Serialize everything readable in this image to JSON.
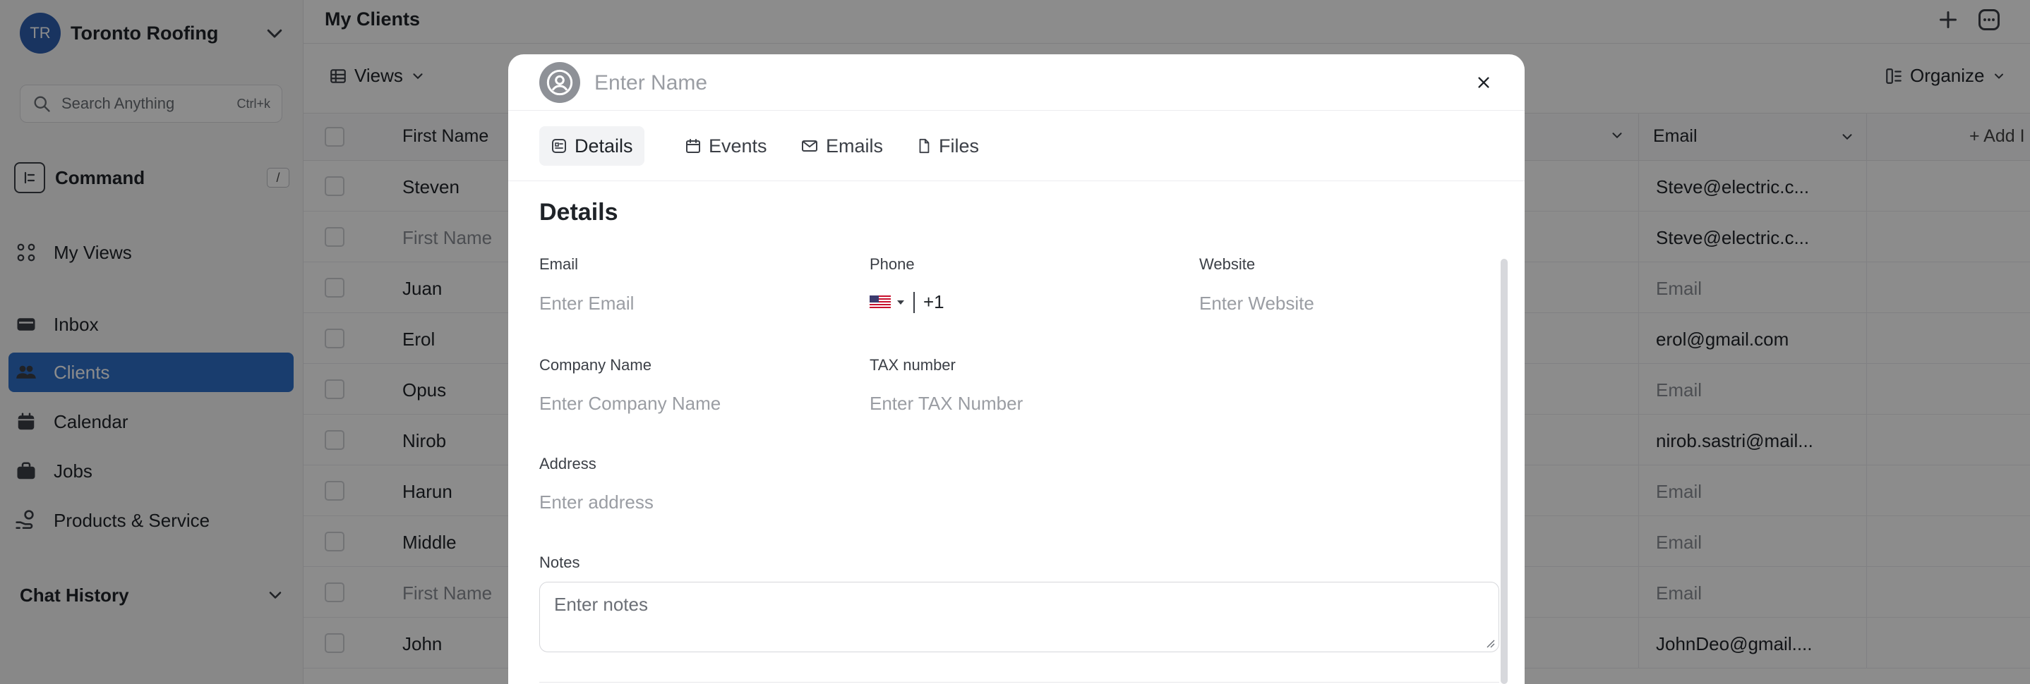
{
  "sidebar": {
    "workspace": {
      "initials": "TR",
      "name": "Toronto Roofing"
    },
    "search": {
      "placeholder": "Search Anything",
      "shortcut": "Ctrl+k"
    },
    "command": {
      "label": "Command",
      "shortcut": "/"
    },
    "items": [
      {
        "label": "My Views",
        "icon": "grid-icon"
      },
      {
        "label": "Inbox",
        "icon": "inbox-icon"
      },
      {
        "label": "Clients",
        "icon": "users-icon",
        "active": true
      },
      {
        "label": "Calendar",
        "icon": "calendar-icon"
      },
      {
        "label": "Jobs",
        "icon": "briefcase-icon"
      },
      {
        "label": "Products & Service",
        "icon": "hand-coin-icon"
      }
    ],
    "chat_history": {
      "label": "Chat History"
    }
  },
  "main": {
    "title": "My Clients",
    "toolbar": {
      "views_label": "Views",
      "organize_label": "Organize"
    },
    "table": {
      "headers": {
        "first_name": "First Name",
        "email": "Email",
        "add_column": "+ Add I"
      },
      "rows": [
        {
          "first": "Steven",
          "first_placeholder": false,
          "email": "Steve@electric.c...",
          "email_placeholder": false
        },
        {
          "first": "First Name",
          "first_placeholder": true,
          "email": "Steve@electric.c...",
          "email_placeholder": false
        },
        {
          "first": "Juan",
          "first_placeholder": false,
          "email": "Email",
          "email_placeholder": true
        },
        {
          "first": "Erol",
          "first_placeholder": false,
          "email": "erol@gmail.com",
          "email_placeholder": false
        },
        {
          "first": "Opus",
          "first_placeholder": false,
          "email": "Email",
          "email_placeholder": true
        },
        {
          "first": "Nirob",
          "first_placeholder": false,
          "email": "nirob.sastri@mail...",
          "email_placeholder": false
        },
        {
          "first": "Harun",
          "first_placeholder": false,
          "email": "Email",
          "email_placeholder": true
        },
        {
          "first": "Middle",
          "first_placeholder": false,
          "email": "Email",
          "email_placeholder": true
        },
        {
          "first": "First Name",
          "first_placeholder": true,
          "email": "Email",
          "email_placeholder": true
        },
        {
          "first": "John",
          "first_placeholder": false,
          "email": "JohnDeo@gmail....",
          "email_placeholder": false
        }
      ]
    }
  },
  "modal": {
    "name_placeholder": "Enter Name",
    "tabs": [
      {
        "label": "Details",
        "icon": "details-icon",
        "active": true
      },
      {
        "label": "Events",
        "icon": "calendar-icon"
      },
      {
        "label": "Emails",
        "icon": "mail-icon"
      },
      {
        "label": "Files",
        "icon": "file-icon"
      }
    ],
    "section_title": "Details",
    "fields": {
      "email": {
        "label": "Email",
        "placeholder": "Enter Email"
      },
      "phone": {
        "label": "Phone",
        "country": "US",
        "code": "+1"
      },
      "website": {
        "label": "Website",
        "placeholder": "Enter Website"
      },
      "company": {
        "label": "Company Name",
        "placeholder": "Enter Company Name"
      },
      "tax": {
        "label": "TAX number",
        "placeholder": "Enter TAX Number"
      },
      "address": {
        "label": "Address",
        "placeholder": "Enter address"
      },
      "notes": {
        "label": "Notes",
        "placeholder": "Enter notes"
      }
    }
  },
  "colors": {
    "accent": "#2f6fc8",
    "avatar": "#2f5fb0",
    "overlay": "rgba(0,0,0,0.45)"
  }
}
